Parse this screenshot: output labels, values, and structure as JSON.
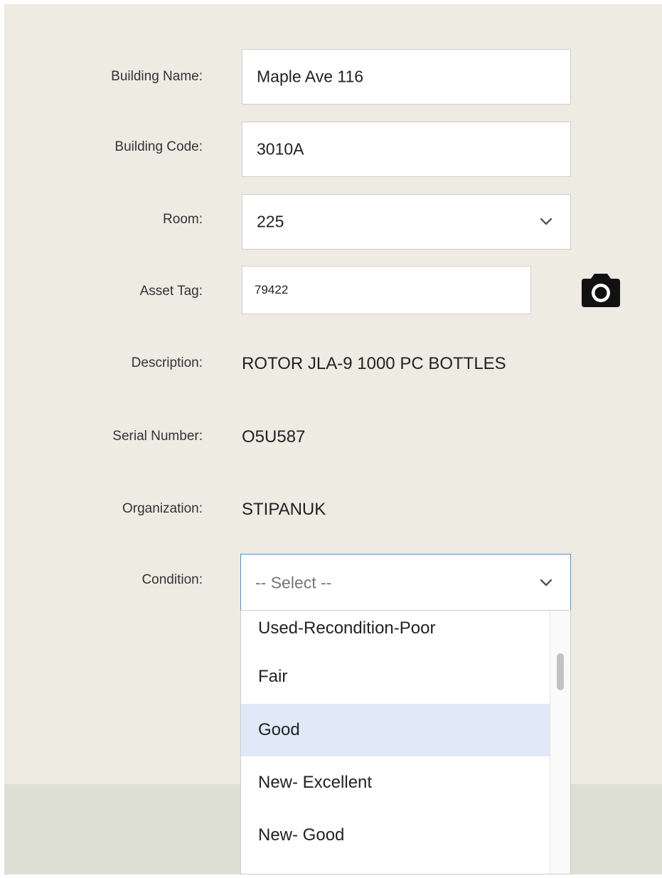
{
  "form": {
    "building_name": {
      "label": "Building Name:",
      "value": "Maple Ave 116"
    },
    "building_code": {
      "label": "Building Code:",
      "value": "3010A"
    },
    "room": {
      "label": "Room:",
      "value": "225"
    },
    "asset_tag": {
      "label": "Asset Tag:",
      "value": "79422"
    },
    "description": {
      "label": "Description:",
      "value": "ROTOR JLA-9 1000 PC BOTTLES"
    },
    "serial_number": {
      "label": "Serial Number:",
      "value": "O5U587"
    },
    "organization": {
      "label": "Organization:",
      "value": "STIPANUK"
    },
    "condition": {
      "label": "Condition:",
      "placeholder": "-- Select --",
      "options": [
        "Used-Recondition-Poor",
        "Fair",
        "Good",
        "New- Excellent",
        "New- Good"
      ],
      "highlighted_option": "Good"
    }
  },
  "icons": {
    "camera": "camera-icon",
    "chevron": "chevron-down-icon"
  },
  "colors": {
    "panel_bg": "#eeebe3",
    "footer_bg": "#dedfd4",
    "focus_border": "#4a90e2",
    "highlight_bg": "#dfe9f8"
  }
}
